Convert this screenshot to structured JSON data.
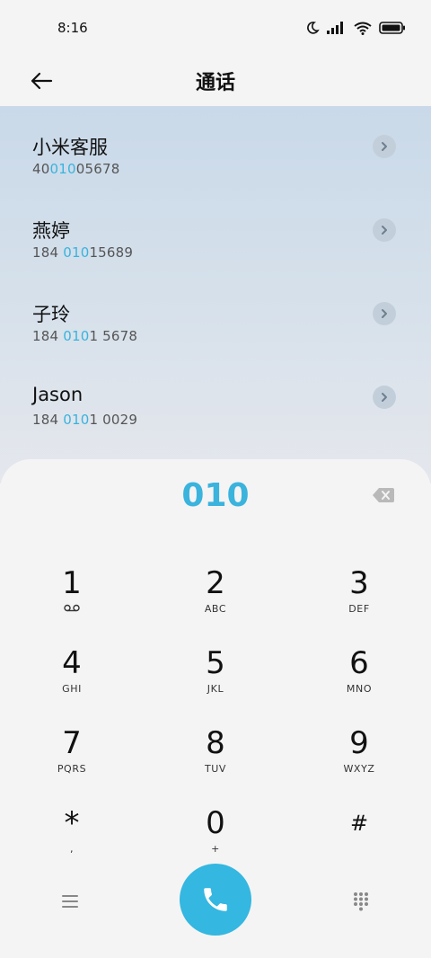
{
  "status_bar": {
    "time": "8:16",
    "icons": [
      "moon-icon",
      "signal-icon",
      "wifi-icon",
      "battery-icon"
    ]
  },
  "header": {
    "title": "通话",
    "back_icon": "arrow-left-icon"
  },
  "search_query": "010",
  "results": [
    {
      "name": "小米客服",
      "number_pre": "40",
      "number_match": "010",
      "number_post": "05678"
    },
    {
      "name": "燕婷",
      "number_pre": "184 ",
      "number_match": "010",
      "number_post": "15689"
    },
    {
      "name": "子玲",
      "number_pre": "184 ",
      "number_match": "010",
      "number_post": "1 5678"
    },
    {
      "name": "Jason",
      "number_pre": "184 ",
      "number_match": "010",
      "number_post": "1 0029"
    }
  ],
  "dialpad": {
    "keys": [
      {
        "digit": "1",
        "letters": ""
      },
      {
        "digit": "2",
        "letters": "ABC"
      },
      {
        "digit": "3",
        "letters": "DEF"
      },
      {
        "digit": "4",
        "letters": "GHI"
      },
      {
        "digit": "5",
        "letters": "JKL"
      },
      {
        "digit": "6",
        "letters": "MNO"
      },
      {
        "digit": "7",
        "letters": "PQRS"
      },
      {
        "digit": "8",
        "letters": "TUV"
      },
      {
        "digit": "9",
        "letters": "WXYZ"
      },
      {
        "digit": "*",
        "letters": ","
      },
      {
        "digit": "0",
        "letters": "+"
      },
      {
        "digit": "#",
        "letters": ""
      }
    ]
  },
  "colors": {
    "accent": "#3ab3dd",
    "call_button": "#34b7e0",
    "results_bg_top": "#c9d9e9",
    "dialpad_bg": "#f4f4f4"
  }
}
